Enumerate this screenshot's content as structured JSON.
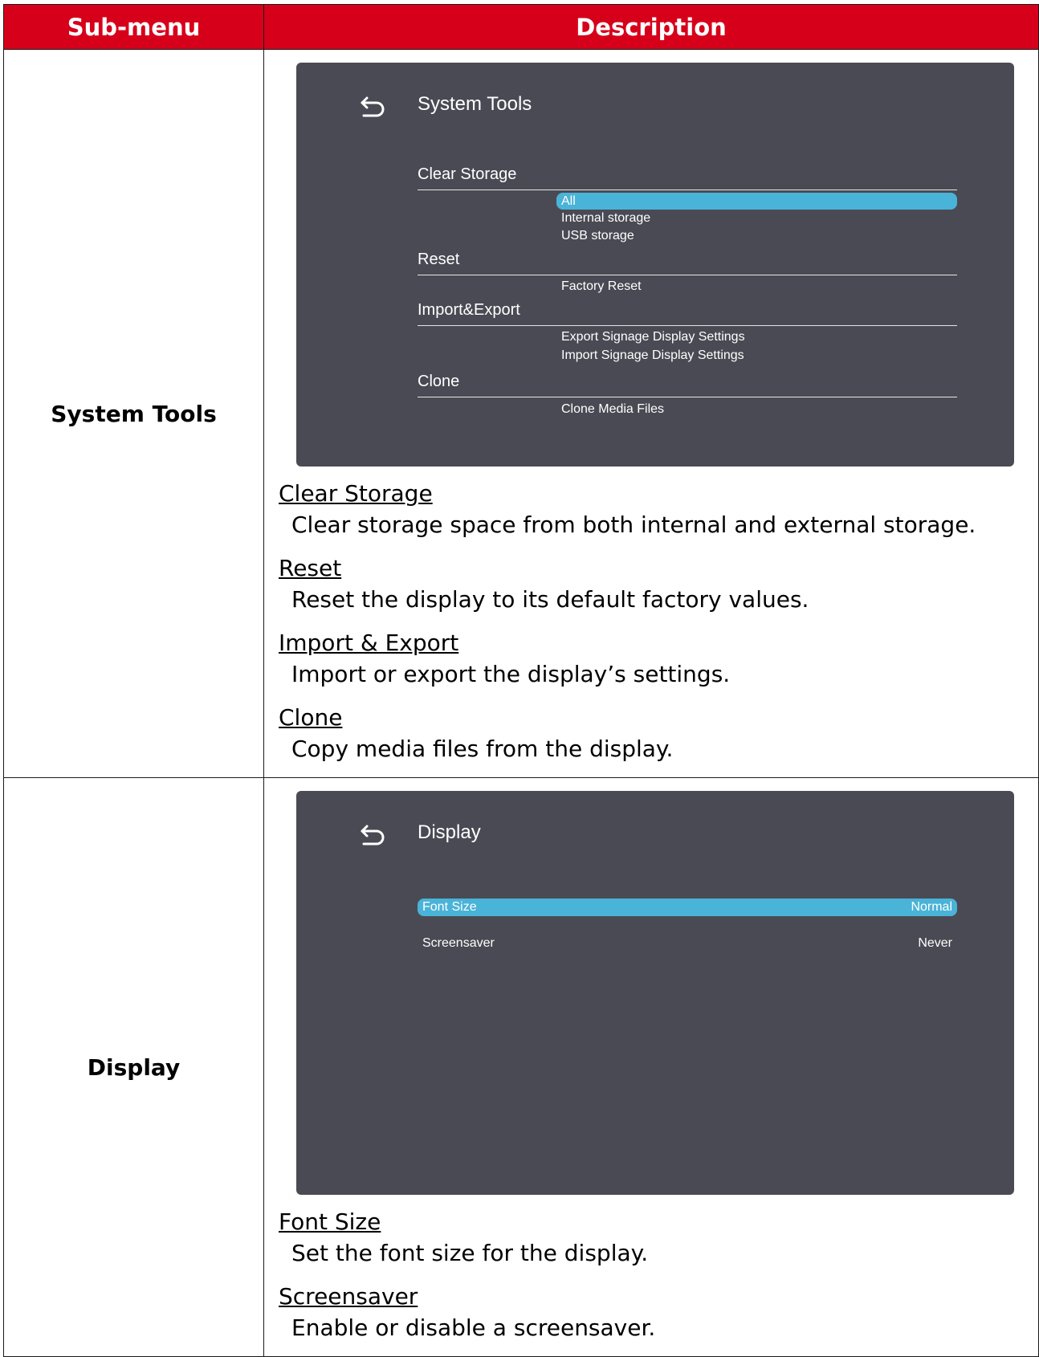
{
  "table": {
    "header_submenu": "Sub-menu",
    "header_description": "Description"
  },
  "rows": [
    {
      "submenu": "System Tools",
      "screen": {
        "title": "System Tools",
        "sections": [
          {
            "label": "Clear Storage",
            "options": [
              "All",
              "Internal storage",
              "USB storage"
            ],
            "selected": 0
          },
          {
            "label": "Reset",
            "options": [
              "Factory Reset"
            ]
          },
          {
            "label": "Import&Export",
            "options": [
              "Export Signage Display Settings",
              "Import Signage Display Settings"
            ]
          },
          {
            "label": "Clone",
            "options": [
              "Clone Media Files"
            ]
          }
        ]
      },
      "notes": [
        {
          "heading": "Clear Storage",
          "text": "Clear storage space from both internal and external storage."
        },
        {
          "heading": "Reset",
          "text": "Reset the display to its default factory values."
        },
        {
          "heading": "Import & Export",
          "text": "Import or export the display’s settings."
        },
        {
          "heading": "Clone",
          "text": "Copy media files from the display."
        }
      ]
    },
    {
      "submenu": "Display",
      "screen": {
        "title": "Display",
        "items": [
          {
            "label": "Font Size",
            "value": "Normal",
            "selected": true
          },
          {
            "label": "Screensaver",
            "value": "Never",
            "selected": false
          }
        ]
      },
      "notes": [
        {
          "heading": "Font Size",
          "text": "Set the font size for the display."
        },
        {
          "heading": "Screensaver",
          "text": "Enable or disable a screensaver."
        }
      ]
    }
  ],
  "colors": {
    "header_red": "#d7001b",
    "screen_bg": "#4a4a54",
    "highlight_blue": "#4ab3d8"
  },
  "icons": [
    "back-arrow-icon"
  ]
}
